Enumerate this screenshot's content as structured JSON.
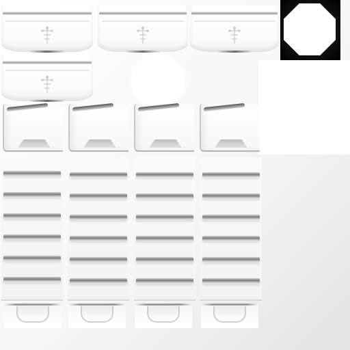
{
  "atlas": {
    "emblem_tiles": [
      "emblem",
      "emblem",
      "emblem",
      "emblem"
    ],
    "bracket_tiles": [
      "bracket",
      "bracket",
      "bracket",
      "bracket"
    ],
    "stripe_columns": 4,
    "stripes_per_column": 6,
    "cup_tiles": [
      "cup",
      "cup",
      "cup",
      "cup"
    ],
    "shapes": [
      "octagon",
      "circle"
    ],
    "colors": {
      "background": "#f3f3f3",
      "shade": "#7a7a7a",
      "dark": "#000000",
      "highlight": "#ffffff"
    },
    "icons": [
      "cross-emblem-icon"
    ]
  }
}
